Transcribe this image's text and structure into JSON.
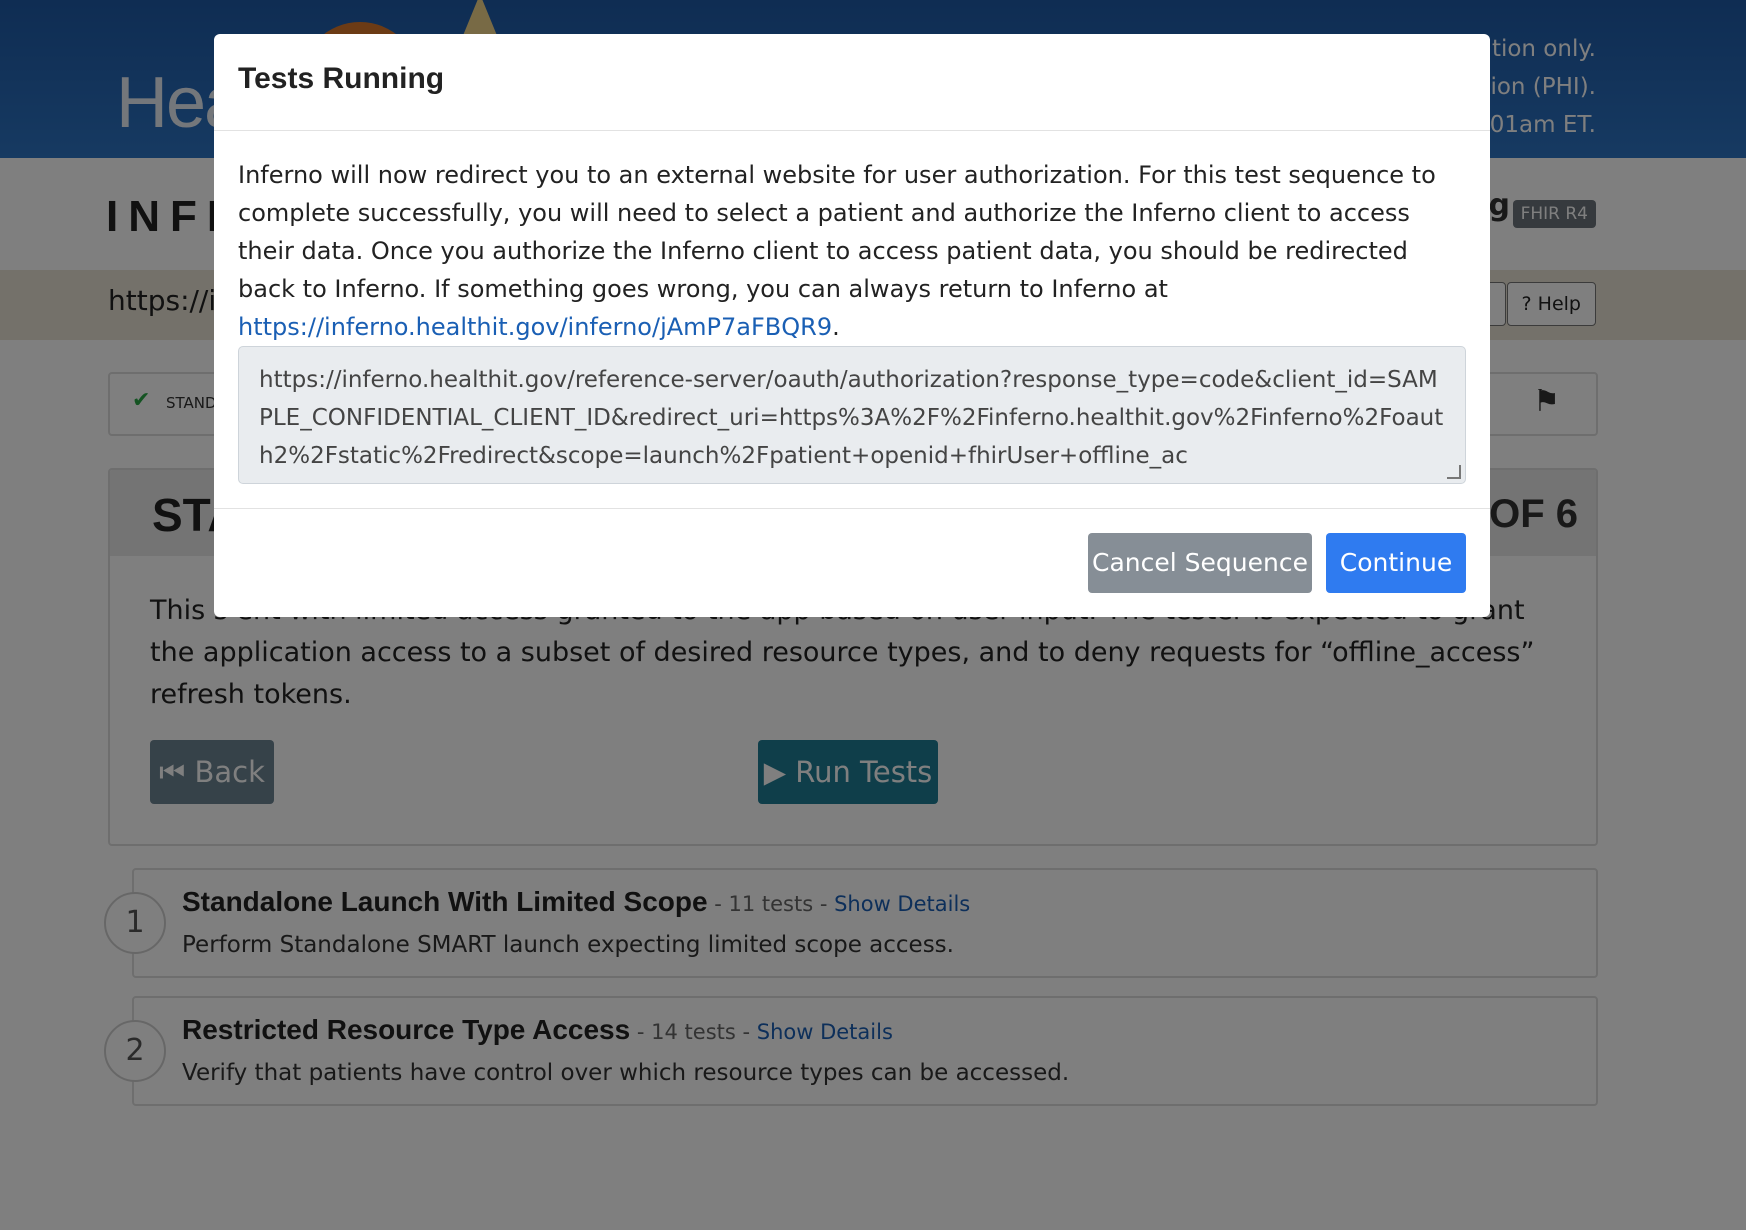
{
  "banner": {
    "logo_text": "Hea",
    "disclaimer_lines": [
      "ation only.",
      "tion (PHI).",
      "2:01am ET."
    ]
  },
  "brand": {
    "title": "INFE",
    "title_suffix": "g",
    "fhir_badge": "FHIR R4"
  },
  "url_bar": {
    "server_url": "https://i",
    "help_label": "Help"
  },
  "status_strip": {
    "label": "STAND"
  },
  "group": {
    "title": "STA",
    "counter": "2 OF 6",
    "description": "This s                                                                                                                                             ent with limited access granted to the app based on user input. The tester is expected to grant the application access to a subset of desired resource types, and to deny requests for “offline_access” refresh tokens.",
    "back_label": "Back",
    "run_tests_label": "Run Tests"
  },
  "sequences": [
    {
      "number": "1",
      "title": "Standalone Launch With Limited Scope",
      "meta": " - 11 tests - ",
      "link": "Show Details",
      "description": "Perform Standalone SMART launch expecting limited scope access."
    },
    {
      "number": "2",
      "title": "Restricted Resource Type Access",
      "meta": " - 14 tests - ",
      "link": "Show Details",
      "description": "Verify that patients have control over which resource types can be accessed."
    }
  ],
  "modal": {
    "title": "Tests Running",
    "body_text": "Inferno will now redirect you to an external website for user authorization. For this test sequence to complete successfully, you will need to select a patient and authorize the Inferno client to access their data. Once you authorize the Inferno client to access patient data, you should be redirected back to Inferno. If something goes wrong, you can always return to Inferno at ",
    "return_link": "https://inferno.healthit.gov/inferno/jAmP7aFBQR9",
    "body_end": ".",
    "auth_url": "https://inferno.healthit.gov/reference-server/oauth/authorization?response_type=code&client_id=SAMPLE_CONFIDENTIAL_CLIENT_ID&redirect_uri=https%3A%2F%2Finferno.healthit.gov%2Finferno%2Foauth2%2Fstatic%2Fredirect&scope=launch%2Fpatient+openid+fhirUser+offline_ac",
    "cancel_label": "Cancel Sequence",
    "continue_label": "Continue"
  }
}
